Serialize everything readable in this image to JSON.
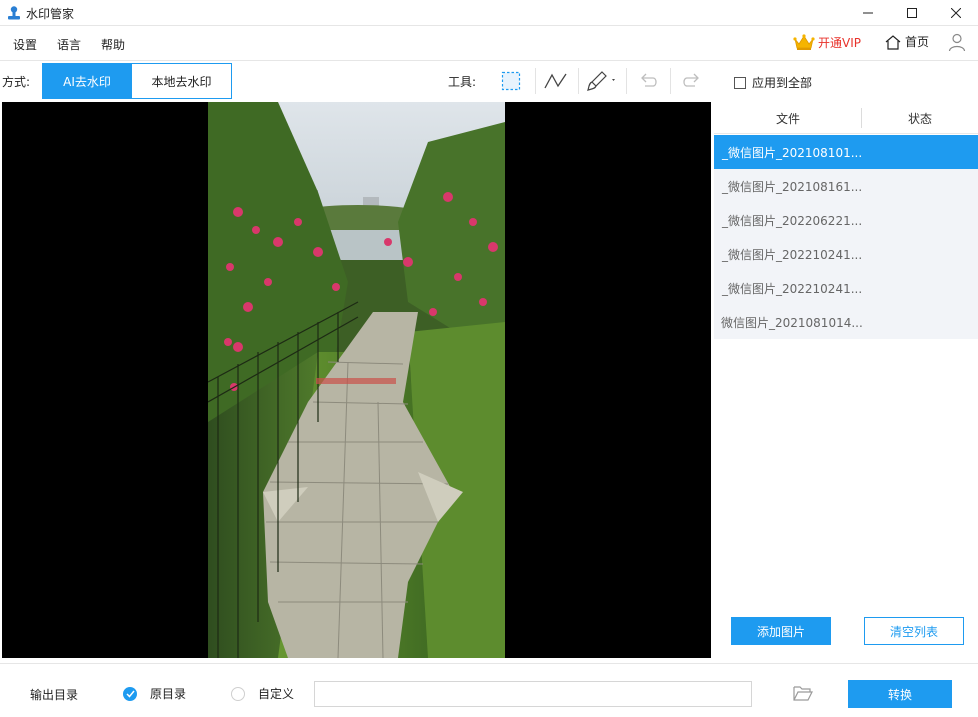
{
  "window": {
    "title": "水印管家"
  },
  "menu": {
    "settings": "设置",
    "language": "语言",
    "help": "帮助",
    "vip": "开通VIP",
    "home": "首页"
  },
  "toolbar": {
    "mode_label": "方式:",
    "mode_ai": "AI去水印",
    "mode_local": "本地去水印",
    "tools_label": "工具:"
  },
  "panel": {
    "apply_all": "应用到全部",
    "col_file": "文件",
    "col_status": "状态",
    "files": [
      {
        "name": "_微信图片_202108101...",
        "status": ""
      },
      {
        "name": "_微信图片_202108161...",
        "status": ""
      },
      {
        "name": "_微信图片_202206221...",
        "status": ""
      },
      {
        "name": "_微信图片_202210241...",
        "status": ""
      },
      {
        "name": "_微信图片_202210241...",
        "status": ""
      },
      {
        "name": "微信图片_2021081014...",
        "status": ""
      }
    ],
    "selected_index": 0,
    "add_button": "添加图片",
    "clear_button": "清空列表"
  },
  "bottom": {
    "output_label": "输出目录",
    "radio_original": "原目录",
    "radio_custom": "自定义",
    "selected_output": "original",
    "path_value": "",
    "convert_button": "转换"
  },
  "colors": {
    "accent": "#1e9bf0",
    "vip": "#e8322b"
  }
}
